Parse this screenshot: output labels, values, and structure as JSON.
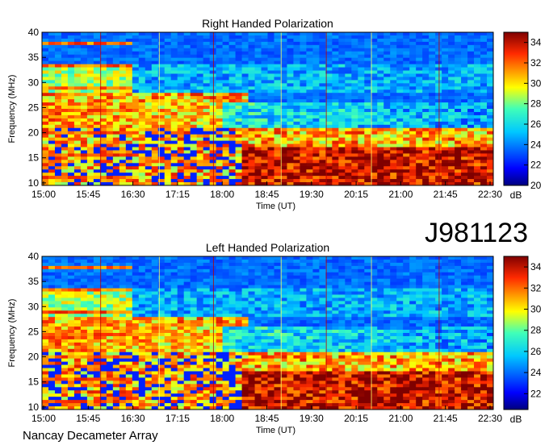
{
  "figure": {
    "observation_id": "J981123",
    "instrument": "Nancay Decameter Array"
  },
  "chart_data": [
    {
      "type": "heatmap",
      "title": "Right Handed Polarization",
      "xlabel": "Time (UT)",
      "ylabel": "Frequency (MHz)",
      "colorbar_label": "dB",
      "x_ticks": [
        "15:00",
        "15:45",
        "16:30",
        "17:15",
        "18:00",
        "18:45",
        "19:30",
        "20:15",
        "21:00",
        "21:45",
        "22:30"
      ],
      "y_ticks": [
        10,
        15,
        20,
        25,
        30,
        35,
        40
      ],
      "ylim": [
        9.5,
        40
      ],
      "colorbar_ticks": [
        20,
        22,
        24,
        26,
        28,
        30,
        32,
        34
      ],
      "clim": [
        20,
        35
      ]
    },
    {
      "type": "heatmap",
      "title": "Left Handed Polarization",
      "xlabel": "Time (UT)",
      "ylabel": "Frequency (MHz)",
      "colorbar_label": "dB",
      "x_ticks": [
        "15:00",
        "15:45",
        "16:30",
        "17:15",
        "18:00",
        "18:45",
        "19:30",
        "20:15",
        "21:00",
        "21:45",
        "22:30"
      ],
      "y_ticks": [
        10,
        15,
        20,
        25,
        30,
        35,
        40
      ],
      "ylim": [
        9.5,
        40
      ],
      "colorbar_ticks": [
        22,
        24,
        26,
        28,
        30,
        32,
        34
      ],
      "clim": [
        20.5,
        35
      ]
    }
  ]
}
